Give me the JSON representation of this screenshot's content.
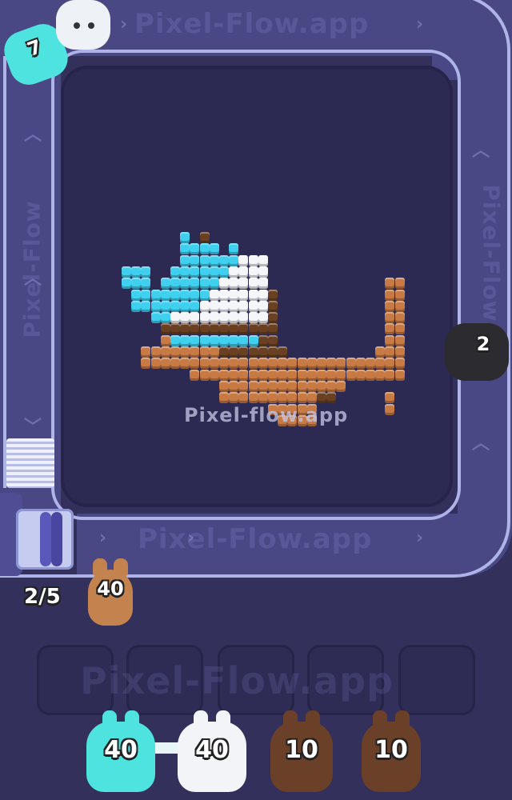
{
  "watermarks": {
    "top": "Pixel-Flow.app",
    "center": "Pixel-flow.app",
    "bottom": "Pixel-Flow.app",
    "slots": "Pixel-Flow.app",
    "side": "Pixel-Flow"
  },
  "hud": {
    "progress": "2/5"
  },
  "track_shooters": [
    {
      "color": "#4fe3e0",
      "count": "7"
    },
    {
      "color": "#f2f4f8",
      "count": ""
    },
    {
      "color": "#2b2b30",
      "count": "2"
    }
  ],
  "launcher_shooter": {
    "color": "#c4834e",
    "count": "40"
  },
  "slots": {
    "total": 5,
    "filled": 0
  },
  "queue": [
    {
      "color": "#4fe3e0",
      "count": "40"
    },
    {
      "color": "#f2f4f8",
      "count": "40"
    },
    {
      "color": "#6b4028",
      "count": "10"
    },
    {
      "color": "#6b4028",
      "count": "10"
    }
  ],
  "colors": {
    "background": "#33305c",
    "board": "#2c2a53",
    "track": "#4a4884",
    "rail": "#aeb3e8",
    "cyan": "#3fd0ef",
    "white": "#f4f6fa",
    "orange": "#c87a45",
    "brown": "#6a4022"
  }
}
